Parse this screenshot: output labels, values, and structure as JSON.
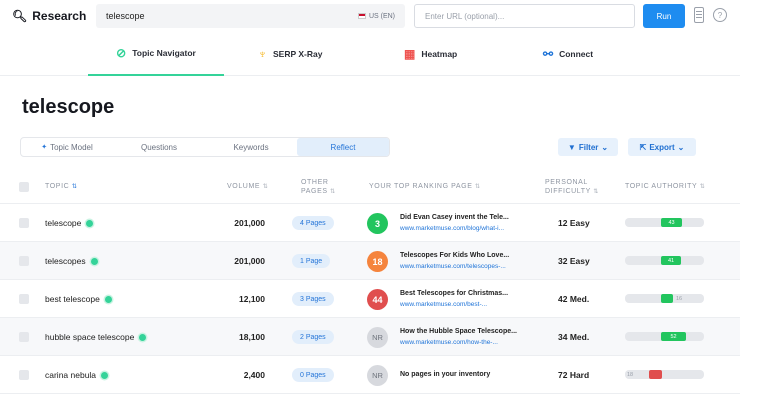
{
  "topbar": {
    "brand": "Research",
    "search_value": "telescope",
    "locale": "US (EN)",
    "url_placeholder": "Enter URL (optional)...",
    "run_label": "Run"
  },
  "nav": {
    "tabs": [
      {
        "label": "Topic Navigator",
        "icon": "⊘"
      },
      {
        "label": "SERP X-Ray",
        "icon": "♆"
      },
      {
        "label": "Heatmap",
        "icon": "▦"
      },
      {
        "label": "Connect",
        "icon": "⚯"
      }
    ]
  },
  "page": {
    "title": "telescope"
  },
  "subtabs": [
    "Topic Model",
    "Questions",
    "Keywords",
    "Reflect"
  ],
  "actions": {
    "filter": "Filter",
    "export": "Export"
  },
  "colors": {
    "accent": "#1e8cf0",
    "green": "#22c55e",
    "orange": "#f5843d",
    "red": "#e04e4e"
  },
  "table": {
    "headers": {
      "topic": "TOPIC",
      "volume": "VOLUME",
      "other_pages_1": "OTHER",
      "other_pages_2": "PAGES",
      "ranking": "YOUR TOP RANKING PAGE",
      "difficulty_1": "PERSONAL",
      "difficulty_2": "DIFFICULTY",
      "authority": "TOPIC AUTHORITY"
    },
    "rows": [
      {
        "topic": "telescope",
        "volume": "201,000",
        "pages": "4 Pages",
        "rank": "3",
        "rank_color": "#22c55e",
        "title": "Did Evan Casey invent the Tele...",
        "url": "www.marketmuse.com/blog/what-i...",
        "difficulty": "12 Easy",
        "authority": "43",
        "auth_fraction": 0.43
      },
      {
        "topic": "telescopes",
        "volume": "201,000",
        "pages": "1 Page",
        "rank": "18",
        "rank_color": "#f5843d",
        "title": "Telescopes For Kids Who Love...",
        "url": "www.marketmuse.com/telescopes-...",
        "difficulty": "32 Easy",
        "authority": "41",
        "auth_fraction": 0.41
      },
      {
        "topic": "best telescope",
        "volume": "12,100",
        "pages": "3 Pages",
        "rank": "44",
        "rank_color": "#e04e4e",
        "title": "Best Telescopes for Christmas...",
        "url": "www.marketmuse.com/best-...",
        "difficulty": "42 Med.",
        "authority": "16",
        "auth_fraction": 0.16
      },
      {
        "topic": "hubble space telescope",
        "volume": "18,100",
        "pages": "2 Pages",
        "rank": "NR",
        "rank_color": "",
        "title": "How the Hubble Space Telescope...",
        "url": "www.marketmuse.com/how-the-...",
        "difficulty": "34 Med.",
        "authority": "52",
        "auth_fraction": 0.52
      },
      {
        "topic": "carina nebula",
        "volume": "2,400",
        "pages": "0 Pages",
        "rank": "NR",
        "rank_color": "",
        "title": "No pages in your inventory",
        "url": "",
        "difficulty": "72 Hard",
        "authority": "18",
        "auth_fraction": 0.18
      }
    ]
  }
}
